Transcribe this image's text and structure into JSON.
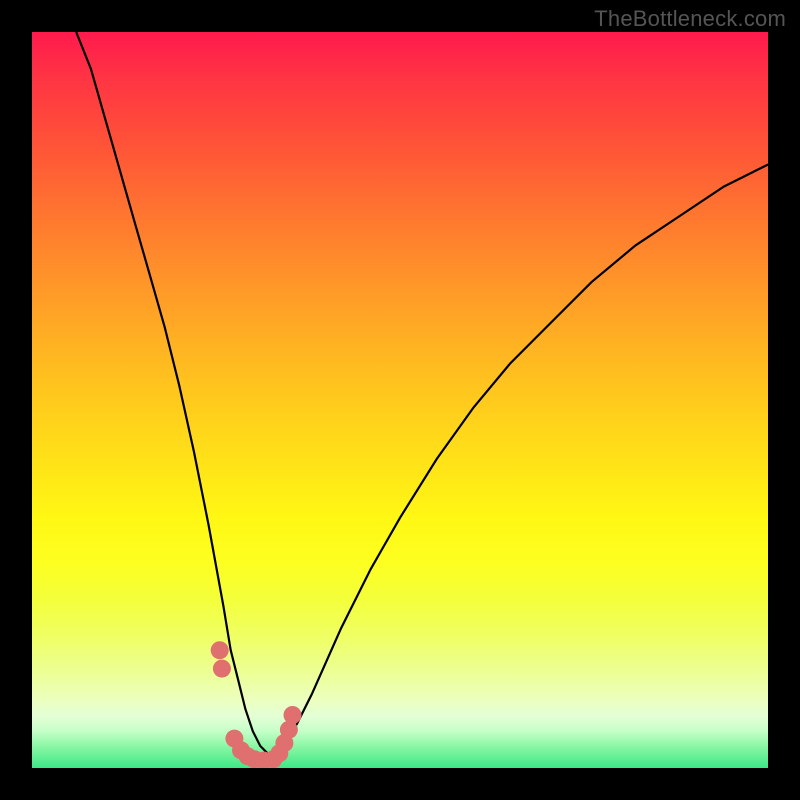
{
  "credit": "TheBottleneck.com",
  "chart_data": {
    "type": "line",
    "title": "",
    "xlabel": "",
    "ylabel": "",
    "xlim": [
      0,
      100
    ],
    "ylim": [
      0,
      100
    ],
    "series": [
      {
        "name": "bottleneck-curve",
        "x": [
          6,
          8,
          10,
          12,
          14,
          16,
          18,
          20,
          22,
          24,
          26,
          27,
          28,
          29,
          30,
          31,
          32,
          33,
          34,
          36,
          38,
          42,
          46,
          50,
          55,
          60,
          65,
          70,
          76,
          82,
          88,
          94,
          100
        ],
        "values": [
          100,
          95,
          88,
          81,
          74,
          67,
          60,
          52,
          43,
          33,
          22,
          16,
          12,
          8,
          5,
          3,
          2,
          2,
          3,
          6,
          10,
          19,
          27,
          34,
          42,
          49,
          55,
          60,
          66,
          71,
          75,
          79,
          82
        ]
      }
    ],
    "markers": {
      "name": "highlight-points",
      "x": [
        25.5,
        25.8,
        27.5,
        28.4,
        29.3,
        30.2,
        31.5,
        32.8,
        33.6,
        34.3,
        34.9,
        35.4
      ],
      "values": [
        16,
        13.5,
        4.0,
        2.4,
        1.6,
        1.2,
        1.0,
        1.2,
        2.0,
        3.4,
        5.2,
        7.2
      ]
    },
    "legend": false,
    "grid": false
  }
}
